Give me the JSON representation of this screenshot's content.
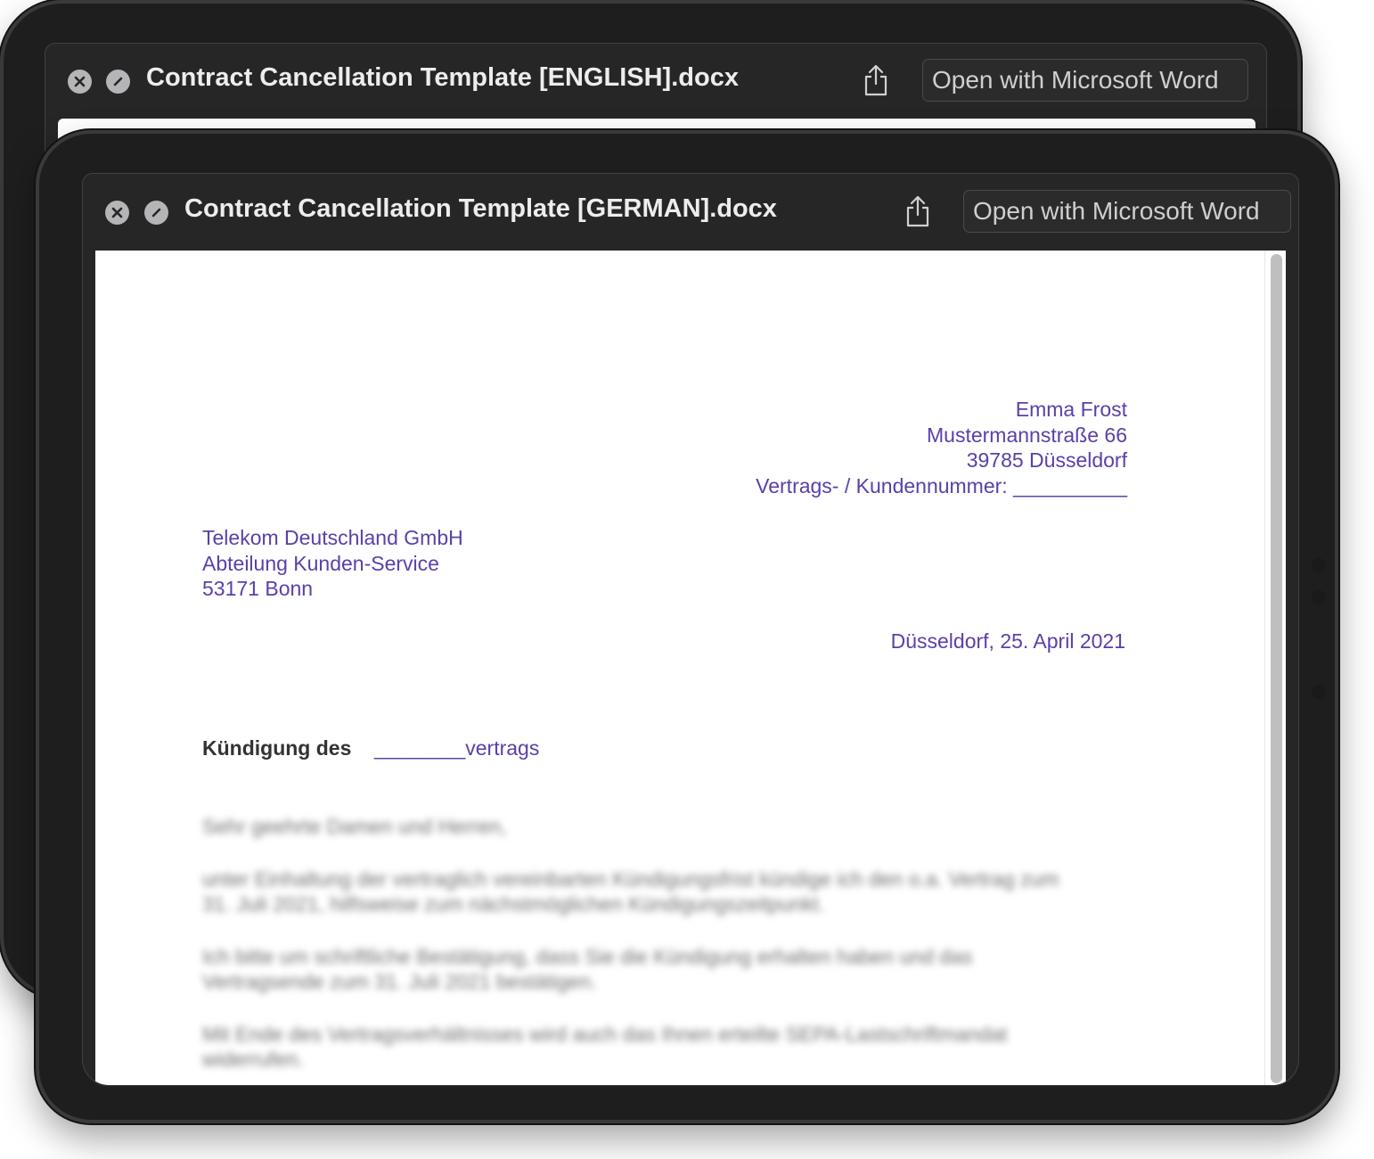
{
  "back_window": {
    "title": "Contract Cancellation Template [ENGLISH].docx",
    "open_button": "Open with Microsoft Word"
  },
  "front_window": {
    "title": "Contract Cancellation Template [GERMAN].docx",
    "open_button": "Open with Microsoft Word"
  },
  "icons": {
    "close": "close-icon",
    "block": "block-icon",
    "share": "share-icon"
  },
  "colors": {
    "accent_text": "#5b3fa8",
    "frame": "#1e1e1f",
    "titlebar": "#262627"
  },
  "document": {
    "sender": {
      "name": "Emma Frost",
      "street": "Mustermannstraße 66",
      "city": "39785 Düsseldorf",
      "contract_number": "Vertrags- / Kundennummer: __________"
    },
    "recipient": {
      "company": "Telekom Deutschland GmbH",
      "department": "Abteilung Kunden-Service",
      "city": "53171 Bonn"
    },
    "date": "Düsseldorf, 25. April 2021",
    "subject": {
      "label": "Kündigung des",
      "value": "________vertrags"
    },
    "body": [
      "Sehr geehrte Damen und Herren,",
      "unter Einhaltung der vertraglich vereinbarten Kündigungsfrist kündige ich den o.a. Vertrag zum 31. Juli 2021, hilfsweise zum nächstmöglichen Kündigungszeitpunkt.",
      "Ich bitte um schriftliche Bestätigung, dass Sie die Kündigung erhalten haben und das Vertragsende zum 31. Juli 2021 bestätigen.",
      "Mit Ende des Vertragsverhältnisses wird auch das Ihnen erteilte SEPA-Lastschriftmandat widerrufen."
    ]
  }
}
